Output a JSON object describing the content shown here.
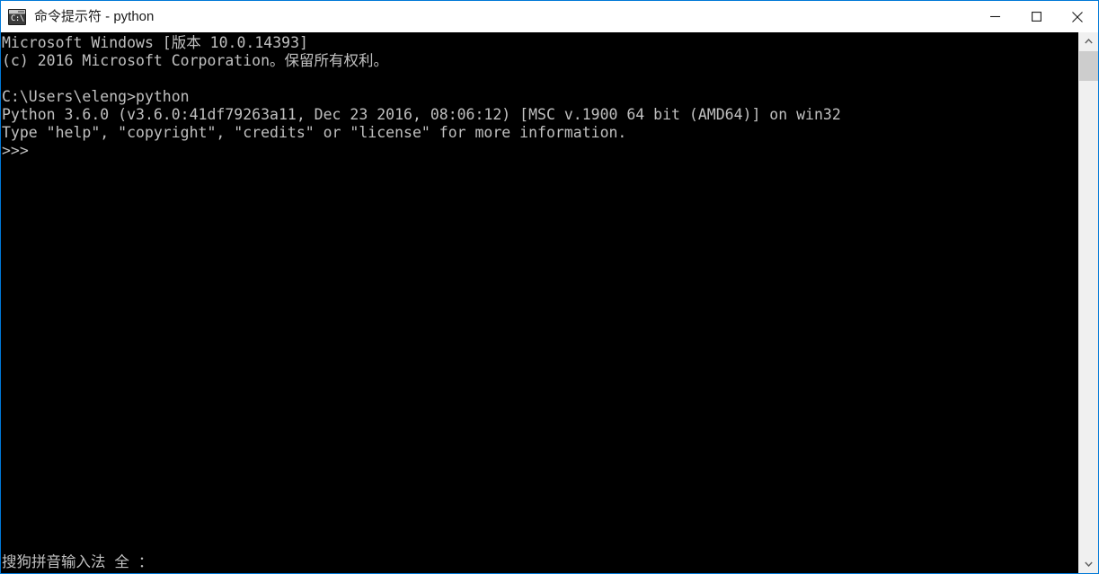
{
  "window": {
    "title": "命令提示符 - python",
    "icon_name": "cmd-icon",
    "icon_glyph": "C:\\.",
    "accent_color": "#0078d7",
    "background_color": "#000000",
    "text_color": "#c0c0c0"
  },
  "titlebar_buttons": {
    "minimize_label": "最小化",
    "maximize_label": "最大化",
    "close_label": "关闭"
  },
  "console": {
    "lines": [
      "Microsoft Windows [版本 10.0.14393]",
      "(c) 2016 Microsoft Corporation。保留所有权利。",
      "",
      "C:\\Users\\eleng>python",
      "Python 3.6.0 (v3.6.0:41df79263a11, Dec 23 2016, 08:06:12) [MSC v.1900 64 bit (AMD64)] on win32",
      "Type \"help\", \"copyright\", \"credits\" or \"license\" for more information.",
      ">>>"
    ],
    "prompt": ">>>"
  },
  "ime": {
    "status_text": "搜狗拼音输入法 全 ："
  },
  "scrollbar": {
    "up_arrow": "scroll-up-arrow",
    "down_arrow": "scroll-down-arrow",
    "thumb": "scroll-thumb"
  }
}
